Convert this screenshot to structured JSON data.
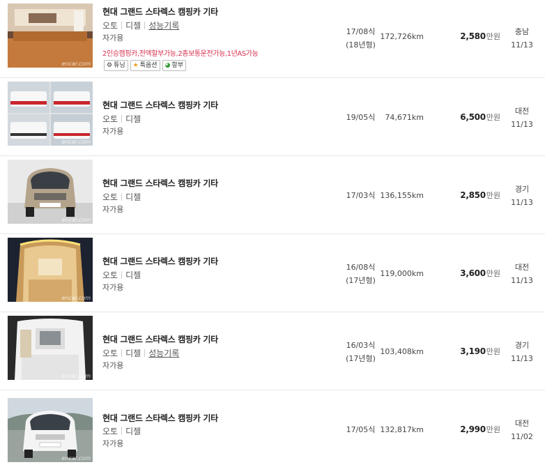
{
  "listings": [
    {
      "title": "현대 그랜드 스타렉스 캠핑카 기타",
      "transmission": "오토",
      "fuel": "디젤",
      "performance_link": "성능기록",
      "usage": "자가용",
      "promo": "2인승캠핑카,전액할부가능,2종보통운전가능,1년AS가능",
      "badges": [
        "튜닝",
        "특옵션",
        "항부"
      ],
      "badge_icons": [
        "gear-icon",
        "star-icon",
        "pie-icon"
      ],
      "year": "17/08식",
      "year_model": "(18년형)",
      "mileage": "172,726km",
      "price": "2,580",
      "price_unit": "만원",
      "region": "충남",
      "date": "11/13",
      "watermark": "encar.com"
    },
    {
      "title": "현대 그랜드 스타렉스 캠핑카 기타",
      "transmission": "오토",
      "fuel": "디젤",
      "usage": "자가용",
      "year": "19/05식",
      "mileage": "74,671km",
      "price": "6,500",
      "price_unit": "만원",
      "region": "대전",
      "date": "11/13",
      "watermark": "encar.com"
    },
    {
      "title": "현대 그랜드 스타렉스 캠핑카 기타",
      "transmission": "오토",
      "fuel": "디젤",
      "usage": "자가용",
      "year": "17/03식",
      "mileage": "136,155km",
      "price": "2,850",
      "price_unit": "만원",
      "region": "경기",
      "date": "11/13",
      "watermark": "encar.com"
    },
    {
      "title": "현대 그랜드 스타렉스 캠핑카 기타",
      "transmission": "오토",
      "fuel": "디젤",
      "usage": "자가용",
      "year": "16/08식",
      "year_model": "(17년형)",
      "mileage": "119,000km",
      "price": "3,600",
      "price_unit": "만원",
      "region": "대전",
      "date": "11/13",
      "watermark": "encar.com"
    },
    {
      "title": "현대 그랜드 스타렉스 캠핑카 기타",
      "transmission": "오토",
      "fuel": "디젤",
      "performance_link": "성능기록",
      "usage": "자가용",
      "year": "16/03식",
      "year_model": "(17년형)",
      "mileage": "103,408km",
      "price": "3,190",
      "price_unit": "만원",
      "region": "경기",
      "date": "11/13",
      "watermark": "encar.com"
    },
    {
      "title": "현대 그랜드 스타렉스 캠핑카 기타",
      "transmission": "오토",
      "fuel": "디젤",
      "usage": "자가용",
      "year": "17/05식",
      "mileage": "132,817km",
      "price": "2,990",
      "price_unit": "만원",
      "region": "대전",
      "date": "11/02",
      "watermark": "encar.com"
    }
  ]
}
